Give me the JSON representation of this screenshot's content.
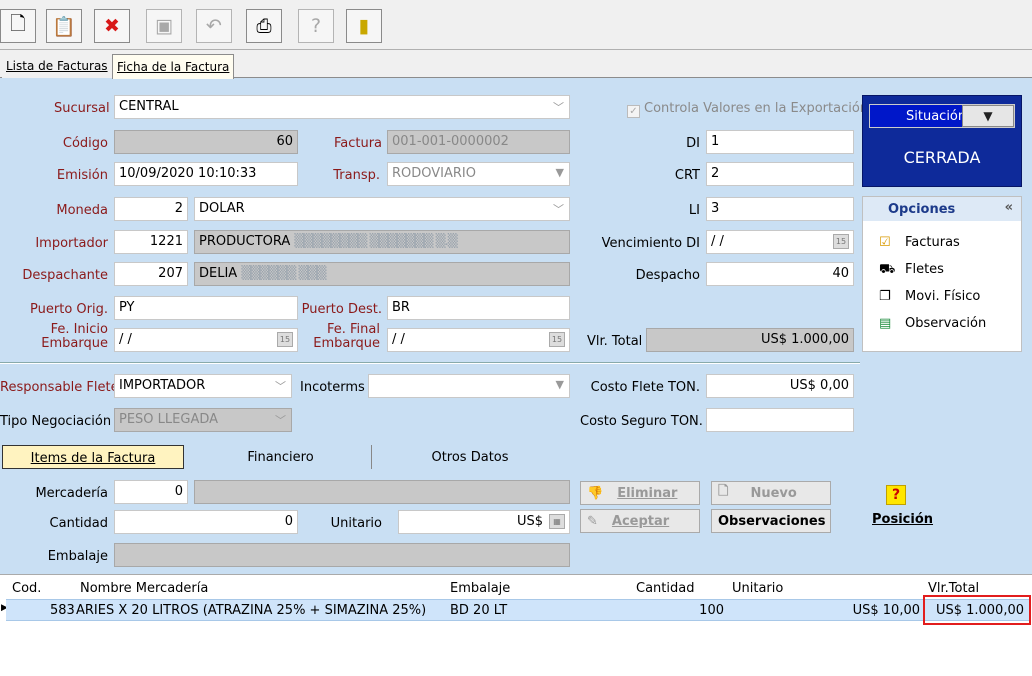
{
  "toolbar": {
    "new_icon": "new-document-icon",
    "edit_icon": "edit-icon",
    "delete_icon": "delete-icon",
    "save_icon": "save-icon",
    "undo_icon": "undo-icon",
    "print_icon": "print-icon",
    "help_icon": "help-icon",
    "exit_icon": "exit-door-icon"
  },
  "tabs": [
    "Lista de Facturas",
    "Ficha de la Factura"
  ],
  "form": {
    "sucursal_label": "Sucursal",
    "sucursal": "CENTRAL",
    "codigo_label": "Código",
    "codigo": "60",
    "factura_label": "Factura",
    "factura": "001-001-0000002",
    "emision_label": "Emisión",
    "emision": "10/09/2020 10:10:33",
    "transp_label": "Transp.",
    "transp": "RODOVIARIO",
    "moneda_label": "Moneda",
    "moneda_code": "2",
    "moneda": "DOLAR",
    "importador_label": "Importador",
    "importador_code": "1221",
    "importador": "PRODUCTORA",
    "despachante_label": "Despachante",
    "despachante_code": "207",
    "despachante": "DELIA",
    "puerto_orig_label": "Puerto Orig.",
    "puerto_orig": "PY",
    "puerto_dest_label": "Puerto Dest.",
    "puerto_dest": "BR",
    "fe_inicio_label_1": "Fe. Inicio",
    "fe_inicio_label_2": "Embarque",
    "fe_inicio": "/ /",
    "fe_final_label_1": "Fe. Final",
    "fe_final_label_2": "Embarque",
    "fe_final": "/ /",
    "controla_label": "Controla Valores en la Exportación",
    "di_label": "DI",
    "di": "1",
    "crt_label": "CRT",
    "crt": "2",
    "li_label": "LI",
    "li": "3",
    "venc_di_label": "Vencimiento DI",
    "venc_di": "/ /",
    "despacho_label": "Despacho",
    "despacho": "40",
    "vlr_total_label": "Vlr. Total",
    "vlr_total": "US$ 1.000,00",
    "resp_flete_label": "Responsable Flete",
    "resp_flete": "IMPORTADOR",
    "incoterms_label": "Incoterms",
    "incoterms": "",
    "tipo_neg_label": "Tipo Negociación",
    "tipo_neg": "PESO LLEGADA",
    "costo_flete_label": "Costo Flete TON.",
    "costo_flete": "US$ 0,00",
    "costo_seguro_label": "Costo Seguro TON.",
    "costo_seguro": ""
  },
  "situacion": {
    "label": "Situación",
    "arrow": "▼",
    "value": "CERRADA"
  },
  "opciones": {
    "title": "Opciones",
    "collapse": "«",
    "items": [
      "Facturas",
      "Fletes",
      "Movi. Físico",
      "Observación"
    ]
  },
  "subtabs": [
    "Items de la Factura",
    "Financiero",
    "Otros Datos"
  ],
  "items_form": {
    "mercaderia_label": "Mercadería",
    "mercaderia_code": "0",
    "cantidad_label": "Cantidad",
    "cantidad": "0",
    "unitario_label": "Unitario",
    "unitario": "US$",
    "embalaje_label": "Embalaje",
    "eliminar": "Eliminar",
    "nuevo": "Nuevo",
    "aceptar": "Aceptar",
    "observaciones": "Observaciones",
    "posicion": "Posición"
  },
  "grid": {
    "columns": [
      "Cod.",
      "Nombre Mercadería",
      "Embalaje",
      "Cantidad",
      "Unitario",
      "Vlr.Total"
    ],
    "rows": [
      {
        "cod": "583",
        "nombre": "ARIES X 20 LITROS (ATRAZINA 25% + SIMAZINA 25%)",
        "embalaje": "BD 20 LT",
        "cantidad": "100",
        "unitario": "US$ 10,00",
        "total": "US$ 1.000,00"
      }
    ]
  },
  "colors": {
    "background": "#c9dff3",
    "situacion_bg": "#0e2a9a",
    "label_red": "#8b1a1a",
    "highlight": "#e21d1d"
  }
}
